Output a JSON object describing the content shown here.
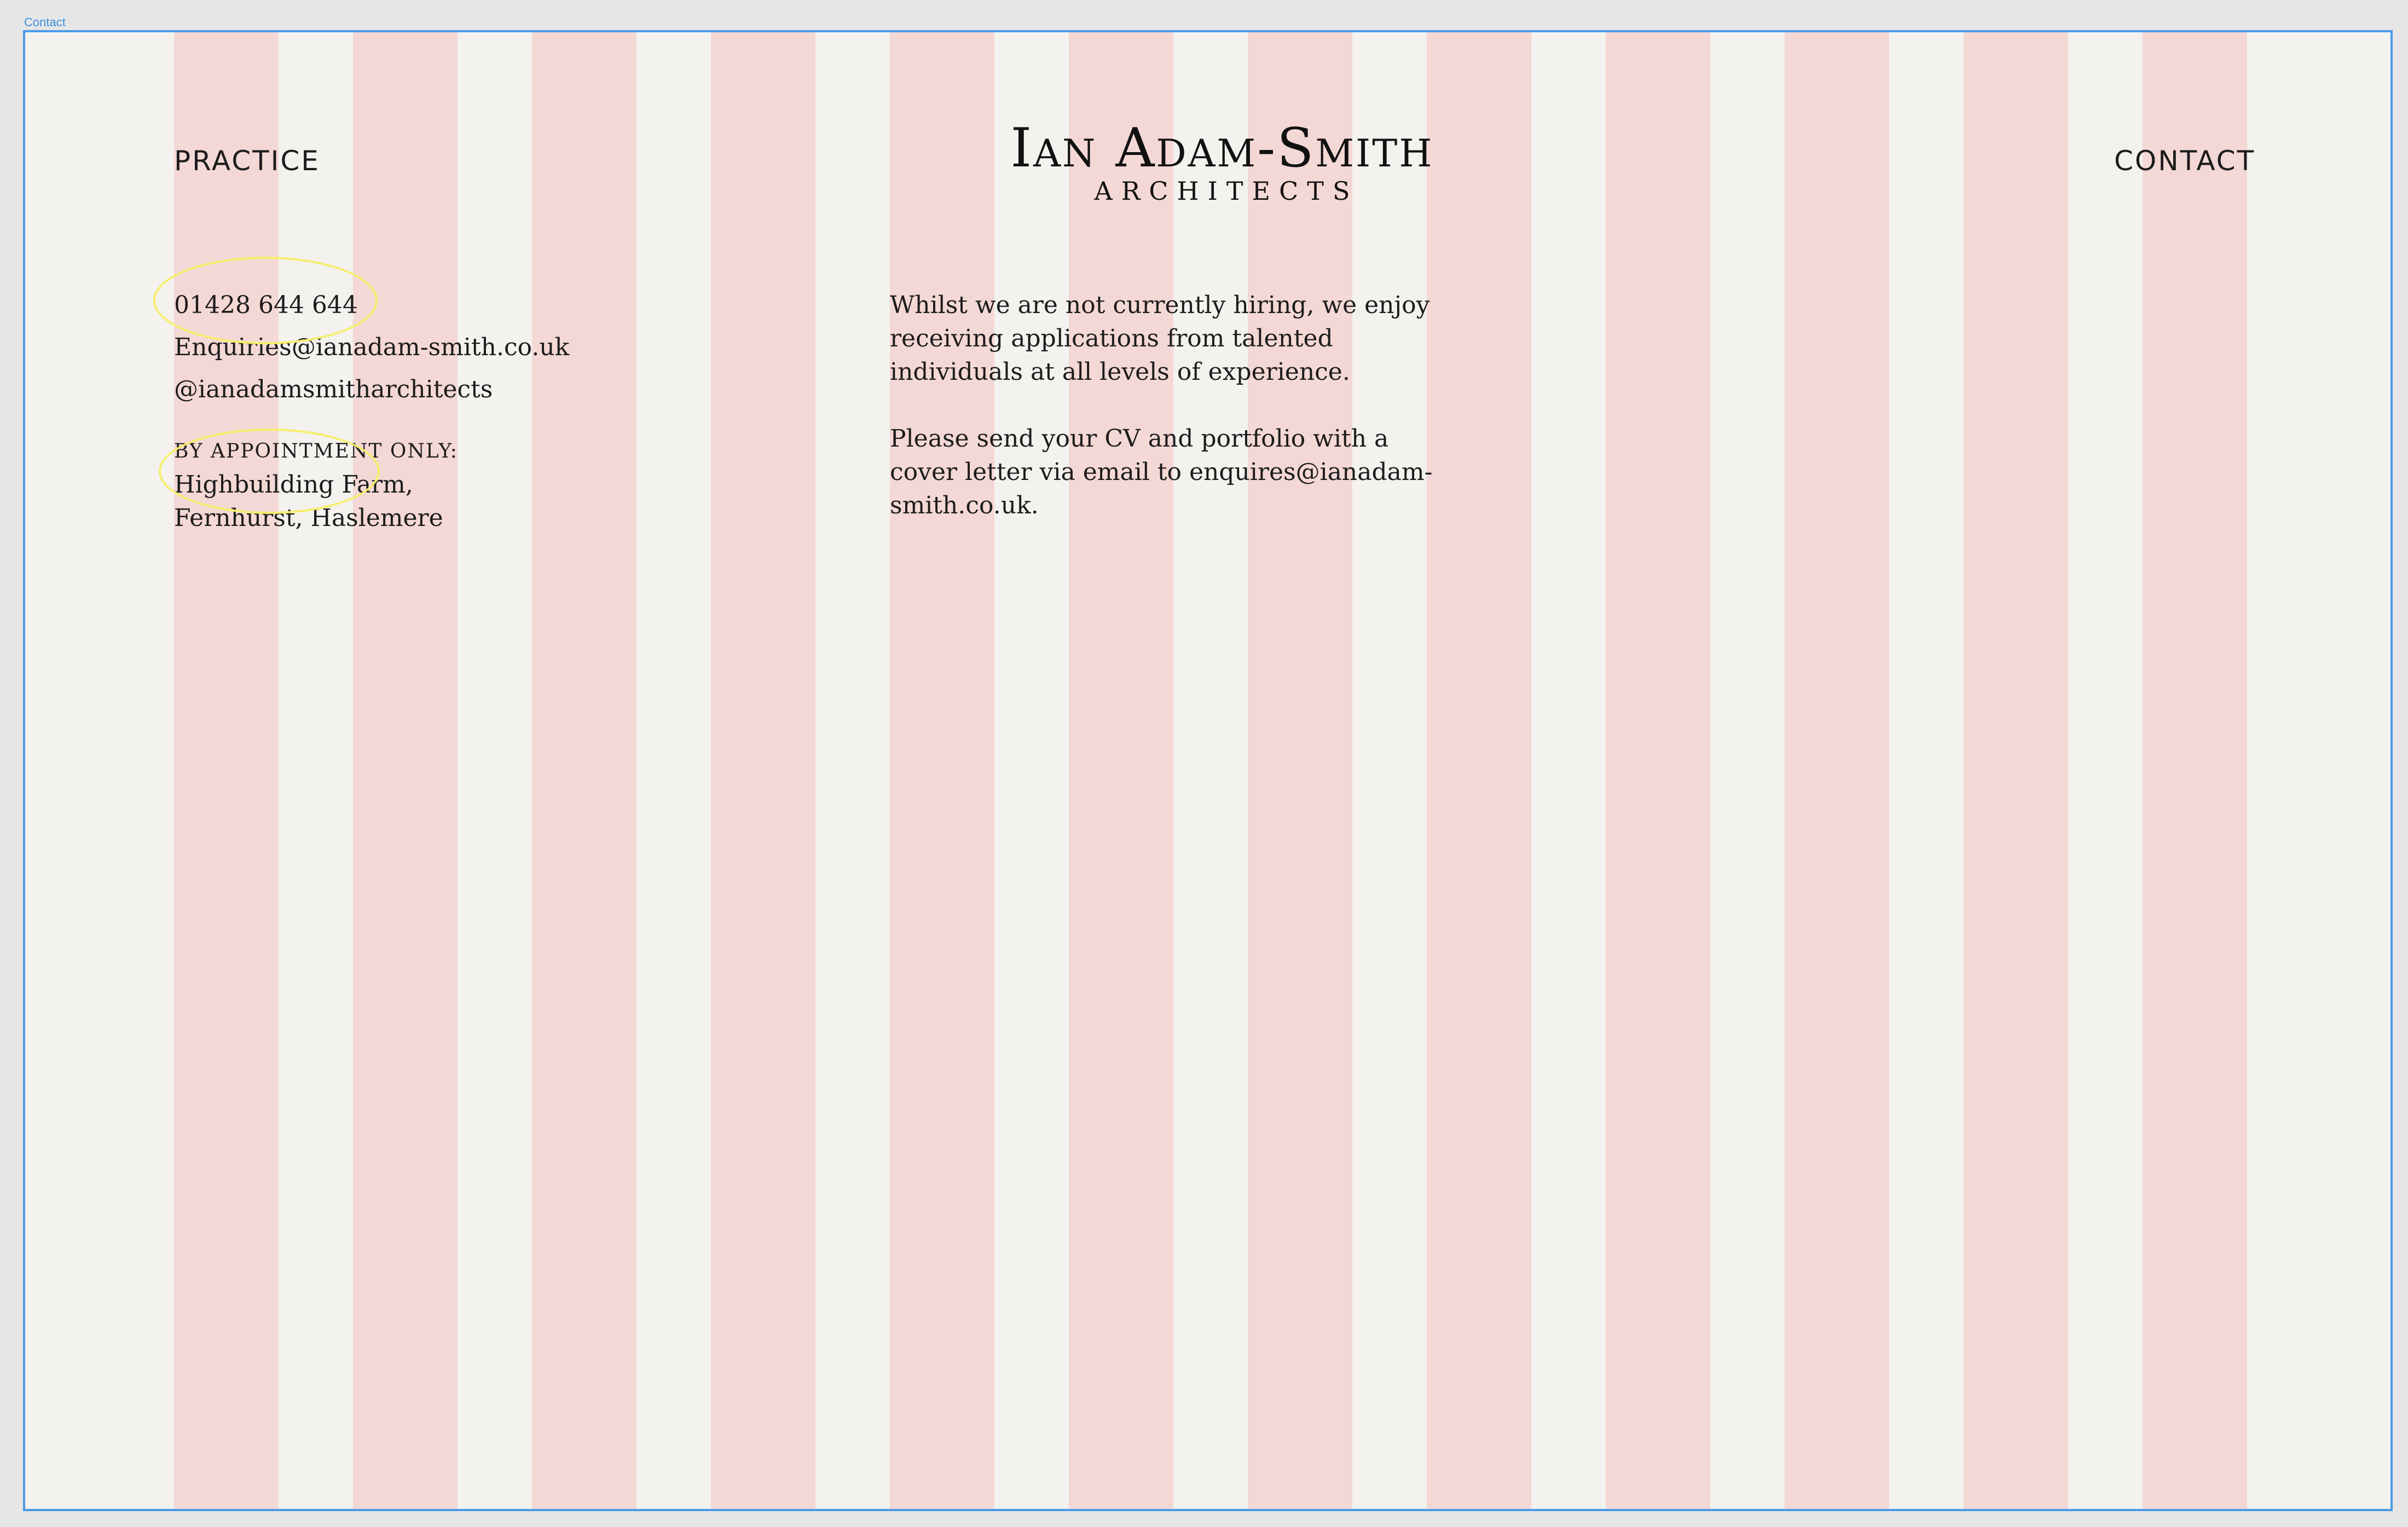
{
  "frame": {
    "label": "Contact"
  },
  "nav": {
    "left_label": "PRACTICE",
    "right_label": "CONTACT"
  },
  "logo": {
    "name": "Ian Adam-Smith",
    "subtitle": "ARCHITECTS"
  },
  "contact": {
    "phone": "01428 644 644",
    "email": "Enquiries@ianadam-smith.co.uk",
    "social": "@ianadamsmitharchitects",
    "appointment_label": "by appointment only:",
    "address_line1": "Highbuilding Farm,",
    "address_line2": "Fernhurst, Haslemere"
  },
  "hiring": {
    "paragraph1": "Whilst we are not currently hiring, we enjoy receiving applications from talented individuals at all levels of experience.",
    "paragraph2": "Please send your CV and portfolio with a cover letter via email to enquires@ianadam-smith.co.uk."
  },
  "colors": {
    "background": "#f3f2ef",
    "grid_column": "#f4d8d5",
    "frame_border": "#4a9ae6",
    "annotation": "#f7ee6b",
    "text": "#1c1c1c"
  }
}
